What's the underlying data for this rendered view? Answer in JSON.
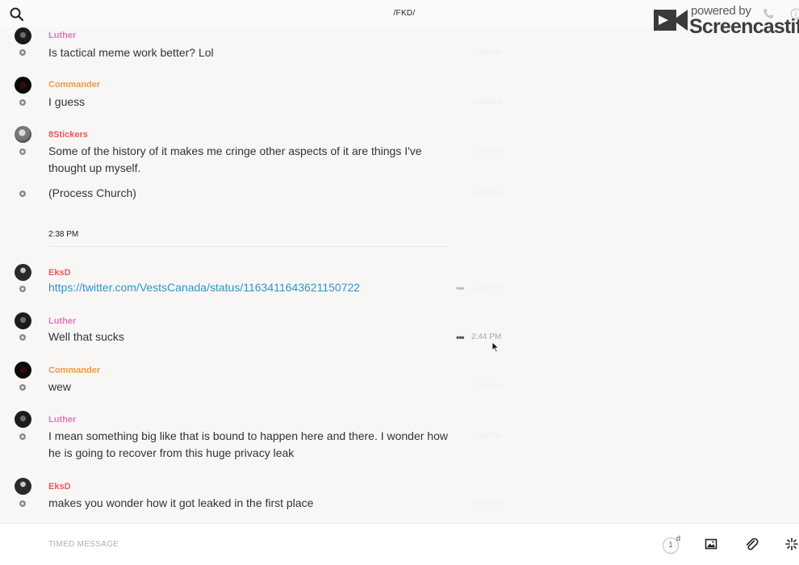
{
  "header": {
    "title": "/FKD/",
    "search_icon": "search-icon",
    "phone_icon": "phone-icon",
    "info_icon": "info-icon"
  },
  "watermark": {
    "powered": "powered by",
    "brand": "Screencastify"
  },
  "messages": [
    {
      "author": "Luther",
      "text": "Is tactical meme work better? Lol",
      "time": "2:44 PM"
    },
    {
      "author": "Commander",
      "text": "I guess",
      "time": "2:45 AM"
    },
    {
      "author": "8Stickers",
      "text": "Some of the history of it makes me cringe other aspects of it are things I've thought up myself.",
      "time": "2:48 AM"
    },
    {
      "author": "",
      "text": "(Process Church)",
      "time": "2:48 AM"
    },
    {
      "author": "EksD",
      "text": "https://twitter.com/VestsCanada/status/1163411643621150722",
      "time": "2:38 PM"
    },
    {
      "author": "Luther",
      "text": "Well that sucks",
      "time": "2:44 PM"
    },
    {
      "author": "Commander",
      "text": "wew",
      "time": "2:45 PM"
    },
    {
      "author": "Luther",
      "text": "I mean something big like that is bound to happen here and there. I wonder how he is going to recover from this huge privacy leak",
      "time": "2:46 PM"
    },
    {
      "author": "EksD",
      "text": "makes you wonder how it got leaked in the first place",
      "time": "2:48 PM"
    }
  ],
  "divider": {
    "label": "2:38 PM"
  },
  "more_glyph": "•••",
  "composer": {
    "placeholder": "TIMED MESSAGE",
    "timer_value": "1",
    "timer_unit": "d"
  },
  "colors": {
    "luther": "#e377c2",
    "commander": "#ee9b45",
    "red_author": "#e65a5a",
    "link": "#2f95c8"
  }
}
